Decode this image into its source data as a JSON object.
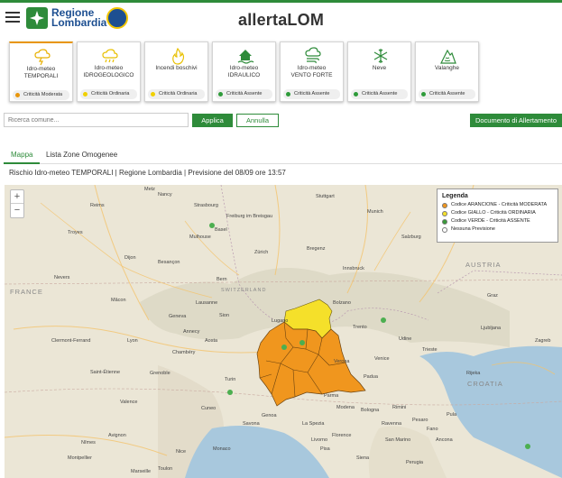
{
  "header": {
    "brand_line1": "Regione",
    "brand_line2": "Lombardia",
    "title": "allertaLOM"
  },
  "cards": [
    {
      "label1": "Idro-meteo",
      "label2": "TEMPORALI",
      "status": "Criticità Moderata",
      "dot": "#e8960c",
      "icon_color": "#e8b000",
      "icon": "storm-icon"
    },
    {
      "label1": "Idro-meteo",
      "label2": "IDROGEOLOGICO",
      "status": "Criticità Ordinaria",
      "dot": "#f0d000",
      "icon_color": "#e8c000",
      "icon": "rain-cloud-icon"
    },
    {
      "label1": "Incendi boschivi",
      "label2": "",
      "status": "Criticità Ordinaria",
      "dot": "#f0d000",
      "icon_color": "#e8c000",
      "icon": "fire-icon"
    },
    {
      "label1": "Idro-meteo",
      "label2": "IDRAULICO",
      "status": "Criticità Assente",
      "dot": "#2e9b3a",
      "icon_color": "#2e8b3a",
      "icon": "flooded-house-icon"
    },
    {
      "label1": "Idro-meteo",
      "label2": "VENTO FORTE",
      "status": "Criticità Assente",
      "dot": "#2e9b3a",
      "icon_color": "#2e8b3a",
      "icon": "wind-icon"
    },
    {
      "label1": "Neve",
      "label2": "",
      "status": "Criticità Assente",
      "dot": "#2e9b3a",
      "icon_color": "#2e8b3a",
      "icon": "snowflake-icon"
    },
    {
      "label1": "Valanghe",
      "label2": "",
      "status": "Criticità Assente",
      "dot": "#2e9b3a",
      "icon_color": "#2e8b3a",
      "icon": "avalanche-icon"
    }
  ],
  "search": {
    "placeholder": "Ricerca comune..."
  },
  "buttons": {
    "apply": "Applica",
    "cancel": "Annulla",
    "document": "Documento di Allertamento"
  },
  "tabs": [
    "Mappa",
    "Lista Zone Omogenee"
  ],
  "subtitle": "Rischio Idro-meteo TEMPORALI | Regione Lombardia | Previsione del 08/09 ore 13:57",
  "legend": {
    "title": "Legenda",
    "items": [
      {
        "label": "Codice ARANCIONE - Criticità MODERATA",
        "color": "#f0961e"
      },
      {
        "label": "Codice GIALLO - Criticità ORDINARIA",
        "color": "#f5e02a"
      },
      {
        "label": "Codice VERDE - Criticità ASSENTE",
        "color": "#3a9b3a"
      },
      {
        "label": "Nessuna Previsione",
        "color": "#ffffff"
      }
    ]
  },
  "zoom": {
    "in": "+",
    "out": "−"
  },
  "map": {
    "countries": [
      "FRANCE",
      "AUSTRIA",
      "CROATIA",
      "SWITZERLAND"
    ],
    "cities": [
      "Stuttgart",
      "Munich",
      "Freiburg im Breisgau",
      "Dijon",
      "Besançon",
      "Basel",
      "Zürich",
      "Bern",
      "Lausanne",
      "Geneva",
      "Lyon",
      "Grenoble",
      "Turin",
      "Parma",
      "Bologna",
      "Florence",
      "Verona",
      "Venice",
      "Trieste",
      "Ljubljana",
      "Zagreb",
      "Innsbruck",
      "Bolzano",
      "Trento",
      "Nice",
      "Marseille",
      "Monaco",
      "Genoa",
      "San Marino",
      "Ravenna",
      "Pula",
      "Rijeka",
      "Clermont-Ferrand",
      "Saint-Étienne",
      "Valence",
      "Avignon",
      "Nîmes",
      "Montpellier",
      "Toulon",
      "Nancy",
      "Metz",
      "Strasbourg",
      "Mulhouse",
      "Bregenz",
      "Salzburg",
      "Graz",
      "Udine",
      "Padua",
      "Modena",
      "Pisa",
      "Perugia",
      "Ancona",
      "Reims",
      "Troyes",
      "Nevers",
      "Mâcon",
      "Annecy",
      "Chambéry",
      "Aosta",
      "Sion",
      "Lugano",
      "Cuneo",
      "Savona",
      "La Spezia",
      "Livorno",
      "Siena",
      "Rimini",
      "Pesaro",
      "Fano"
    ]
  }
}
